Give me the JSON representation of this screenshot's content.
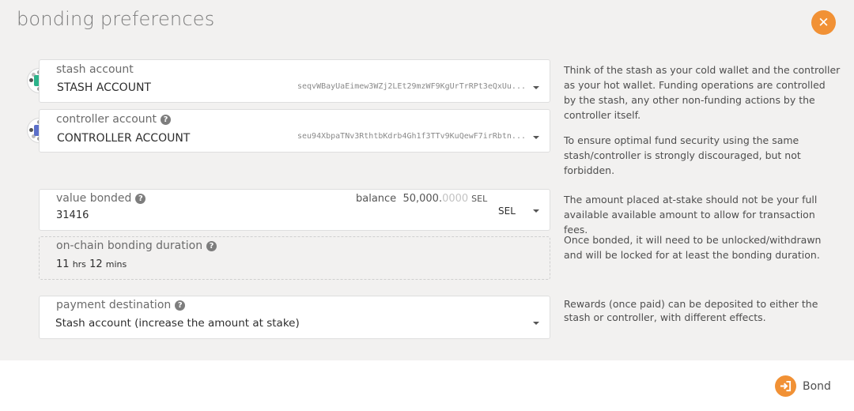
{
  "modal": {
    "title": "bonding preferences",
    "close_icon": "close-icon"
  },
  "stash": {
    "label": "stash account",
    "account_name": "STASH ACCOUNT",
    "address": "seqvWBayUaEimew3WZj2LEt29mzWF9KgUrTrRPt3eQxUu...",
    "identicon_color": "#2db38a"
  },
  "controller": {
    "label": "controller account",
    "account_name": "CONTROLLER ACCOUNT",
    "address": "seu94XbpaTNv3RthtbKdrb4Gh1f3TTv9KuQewF7irRbtn...",
    "identicon_color": "#5b6fc9"
  },
  "help": {
    "stash_1": "Think of the stash as your cold wallet and the controller as your hot wallet. Funding operations are controlled by the stash, any other non-funding actions by the controller itself.",
    "stash_2": "To ensure optimal fund security using the same stash/controller is strongly discouraged, but not forbidden.",
    "value": "The amount placed at-stake should not be your full available available amount to allow for transaction fees.",
    "duration": "Once bonded, it will need to be unlocked/withdrawn and will be locked for at least the bonding duration.",
    "destination": "Rewards (once paid) can be deposited to either the stash or controller, with different effects."
  },
  "value_bonded": {
    "label": "value bonded",
    "value": "31416",
    "balance_label": "balance",
    "balance_int": "50,000.",
    "balance_dec": "0000",
    "balance_unit": "SEL",
    "unit": "SEL"
  },
  "duration": {
    "label": "on-chain bonding duration",
    "hours": "11",
    "hours_unit": "hrs",
    "mins": "12",
    "mins_unit": "mins"
  },
  "destination": {
    "label": "payment destination",
    "value": "Stash account (increase the amount at stake)"
  },
  "footer": {
    "bond_label": "Bond",
    "bond_icon": "sign-in-icon",
    "accent": "#f19135"
  }
}
